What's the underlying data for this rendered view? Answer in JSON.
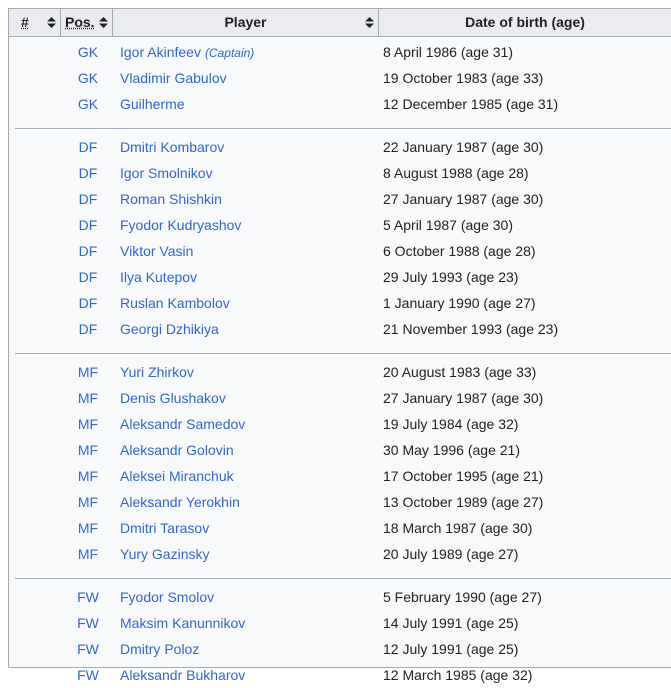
{
  "header": {
    "num": "#",
    "pos": "Pos.",
    "player": "Player",
    "dob": "Date of birth (age)"
  },
  "groups": [
    {
      "rows": [
        {
          "pos": "GK",
          "name": "Igor Akinfeev",
          "note": "(Captain)",
          "dob": "8 April 1986 (age 31)"
        },
        {
          "pos": "GK",
          "name": "Vladimir Gabulov",
          "dob": "19 October 1983 (age 33)"
        },
        {
          "pos": "GK",
          "name": "Guilherme",
          "dob": "12 December 1985 (age 31)"
        }
      ]
    },
    {
      "rows": [
        {
          "pos": "DF",
          "name": "Dmitri Kombarov",
          "dob": "22 January 1987 (age 30)"
        },
        {
          "pos": "DF",
          "name": "Igor Smolnikov",
          "dob": "8 August 1988 (age 28)"
        },
        {
          "pos": "DF",
          "name": "Roman Shishkin",
          "dob": "27 January 1987 (age 30)"
        },
        {
          "pos": "DF",
          "name": "Fyodor Kudryashov",
          "dob": "5 April 1987 (age 30)"
        },
        {
          "pos": "DF",
          "name": "Viktor Vasin",
          "dob": "6 October 1988 (age 28)"
        },
        {
          "pos": "DF",
          "name": "Ilya Kutepov",
          "dob": "29 July 1993 (age 23)"
        },
        {
          "pos": "DF",
          "name": "Ruslan Kambolov",
          "dob": "1 January 1990 (age 27)"
        },
        {
          "pos": "DF",
          "name": "Georgi Dzhikiya",
          "dob": "21 November 1993 (age 23)"
        }
      ]
    },
    {
      "rows": [
        {
          "pos": "MF",
          "name": "Yuri Zhirkov",
          "dob": "20 August 1983 (age 33)"
        },
        {
          "pos": "MF",
          "name": "Denis Glushakov",
          "dob": "27 January 1987 (age 30)"
        },
        {
          "pos": "MF",
          "name": "Aleksandr Samedov",
          "dob": "19 July 1984 (age 32)"
        },
        {
          "pos": "MF",
          "name": "Aleksandr Golovin",
          "dob": "30 May 1996 (age 21)"
        },
        {
          "pos": "MF",
          "name": "Aleksei Miranchuk",
          "dob": "17 October 1995 (age 21)"
        },
        {
          "pos": "MF",
          "name": "Aleksandr Yerokhin",
          "dob": "13 October 1989 (age 27)"
        },
        {
          "pos": "MF",
          "name": "Dmitri Tarasov",
          "dob": "18 March 1987 (age 30)"
        },
        {
          "pos": "MF",
          "name": "Yury Gazinsky",
          "dob": "20 July 1989 (age 27)"
        }
      ]
    },
    {
      "rows": [
        {
          "pos": "FW",
          "name": "Fyodor Smolov",
          "dob": "5 February 1990 (age 27)"
        },
        {
          "pos": "FW",
          "name": "Maksim Kanunnikov",
          "dob": "14 July 1991 (age 25)"
        },
        {
          "pos": "FW",
          "name": "Dmitry Poloz",
          "dob": "12 July 1991 (age 25)"
        },
        {
          "pos": "FW",
          "name": "Aleksandr Bukharov",
          "dob": "12 March 1985 (age 32)"
        }
      ]
    }
  ]
}
